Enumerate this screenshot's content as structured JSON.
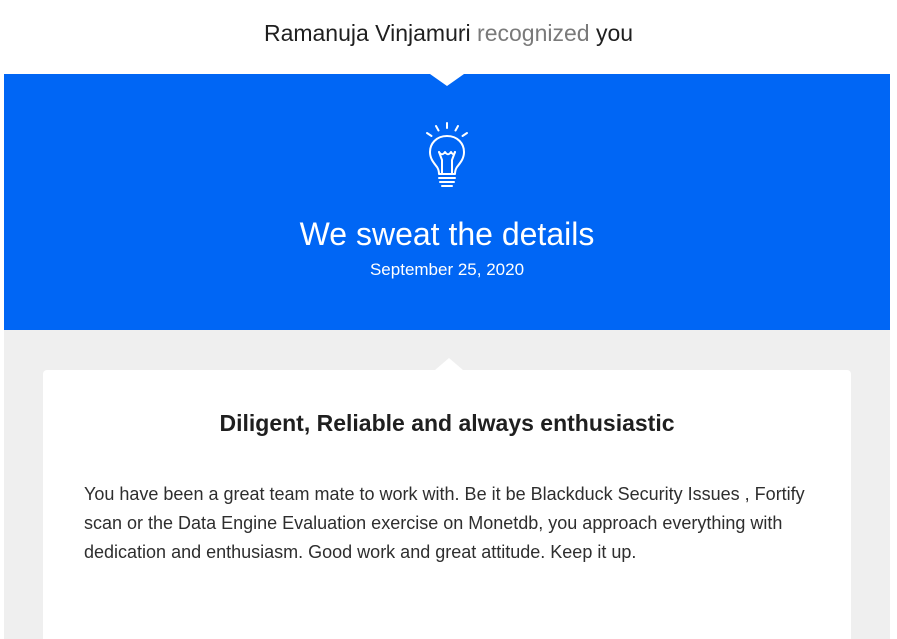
{
  "header": {
    "giver": "Ramanuja Vinjamuri",
    "verb": "recognized",
    "recipient": "you"
  },
  "banner": {
    "icon": "lightbulb-icon",
    "title": "We sweat the details",
    "date": "September 25, 2020",
    "color": "#0066f5"
  },
  "card": {
    "title": "Diligent, Reliable and always enthusiastic",
    "message": "You have been a great team mate to work with. Be it be Blackduck Security Issues , Fortify scan or the Data Engine Evaluation exercise on Monetdb, you approach everything with dedication and enthusiasm. Good work and great attitude. Keep it up."
  }
}
